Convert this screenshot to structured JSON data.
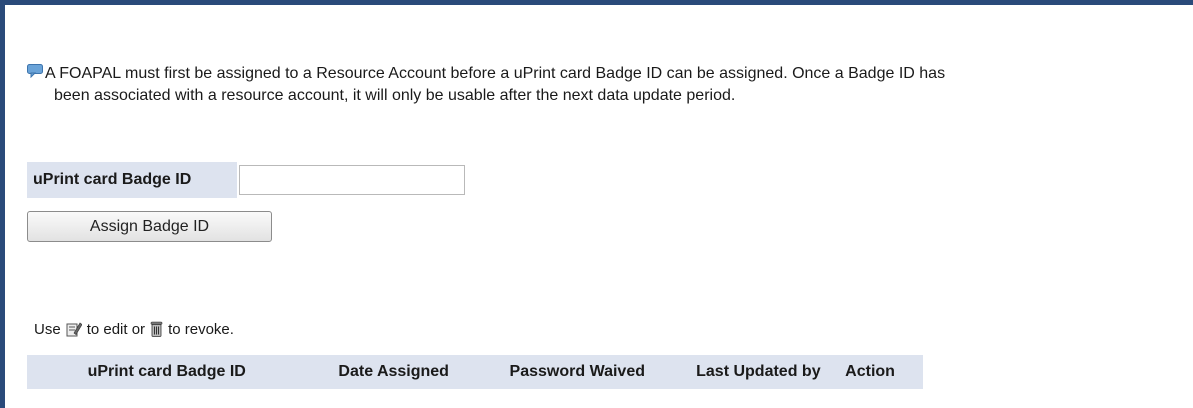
{
  "notice": {
    "line1": "A FOAPAL must first be assigned to a Resource Account before a uPrint card Badge ID can be assigned. Once a Badge ID has",
    "line2": "been associated with a resource account, it will only be usable after the next data update period."
  },
  "form": {
    "badge_label": "uPrint card Badge ID",
    "badge_value": "",
    "assign_button": "Assign Badge ID"
  },
  "hint": {
    "use": "Use",
    "edit_text": "to edit or",
    "revoke_text": "to revoke.",
    "edit_icon": "edit-icon",
    "revoke_icon": "trash-icon"
  },
  "table": {
    "headers": [
      "uPrint card Badge ID",
      "Date Assigned",
      "Password Waived",
      "Last Updated by",
      "Action"
    ]
  },
  "colors": {
    "frame_border": "#2a4a7a",
    "label_bg": "#dde3ef"
  }
}
